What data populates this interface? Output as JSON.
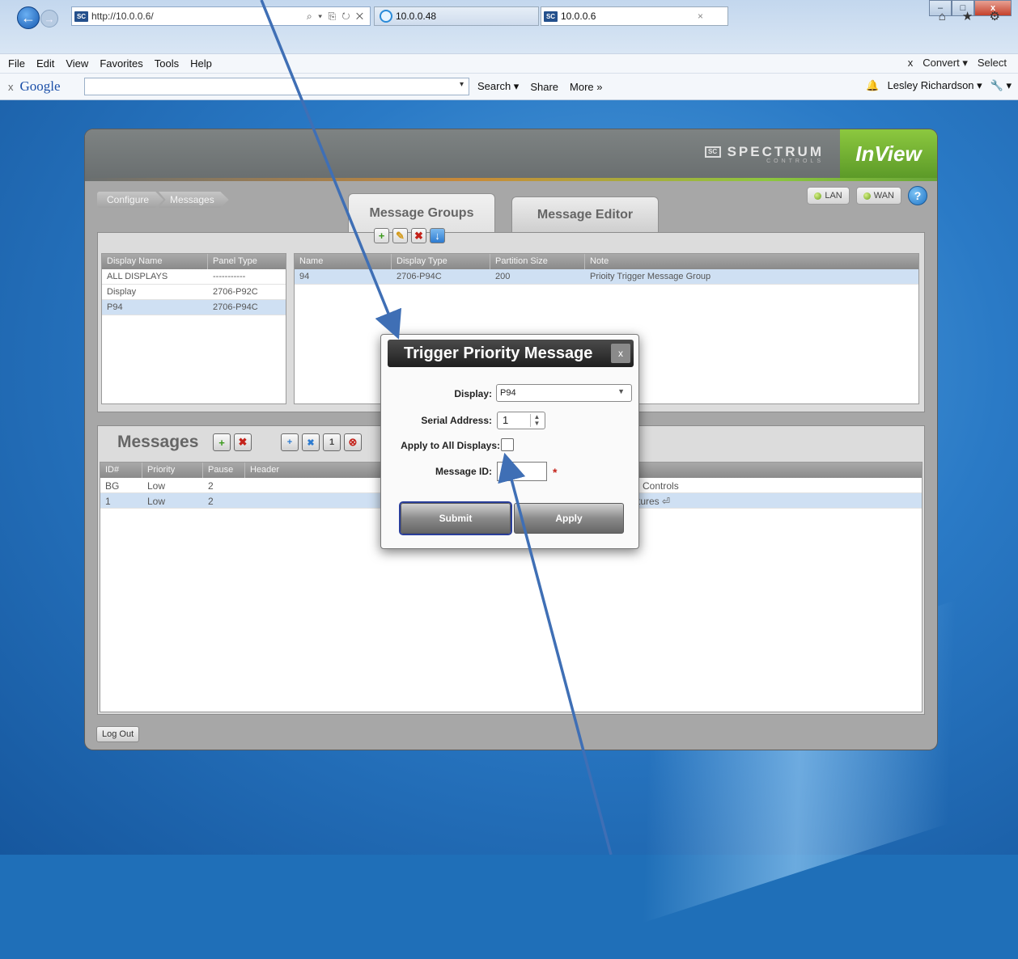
{
  "browser": {
    "address": "http://10.0.0.6/",
    "tabs": [
      {
        "label": "10.0.0.48"
      },
      {
        "label": "10.0.0.6",
        "close": "×"
      }
    ],
    "window_buttons": {
      "minimize": "–",
      "maximize": "□",
      "close": "x"
    },
    "right_icons": "⌂ ★ ⚙",
    "menu": [
      "File",
      "Edit",
      "View",
      "Favorites",
      "Tools",
      "Help"
    ],
    "menu_right": {
      "x": "x",
      "convert": "Convert ▾",
      "select": "Select"
    },
    "google": {
      "x": "x",
      "logo": "Google",
      "dropdown": "▾",
      "search": "Search ▾",
      "share": "Share",
      "more": "More »",
      "user": "Lesley Richardson ▾",
      "wrench": "🔧 ▾"
    }
  },
  "app": {
    "brand": "SPECTRUM",
    "brand_sub": "CONTROLS",
    "product": "InView",
    "breadcrumb": [
      "Configure",
      "Messages"
    ],
    "status": {
      "lan": "LAN",
      "wan": "WAN",
      "help": "?"
    },
    "tabs": {
      "groups": "Message Groups",
      "editor": "Message Editor"
    },
    "displays_table": {
      "columns": [
        "Display Name",
        "Panel Type"
      ],
      "rows": [
        [
          "ALL DISPLAYS",
          "-----------"
        ],
        [
          "Display",
          "2706-P92C"
        ],
        [
          "P94",
          "2706-P94C"
        ]
      ]
    },
    "groups_table": {
      "columns": [
        "Name",
        "Display Type",
        "Partition Size",
        "Note"
      ],
      "rows": [
        [
          "94",
          "2706-P94C",
          "200",
          "Prioity Trigger Message Group"
        ]
      ]
    },
    "messages": {
      "title": "Messages",
      "columns": [
        "ID#",
        "Priority",
        "Pause",
        "Header"
      ],
      "rows": [
        {
          "id": "BG",
          "priority": "Low",
          "pause": "2",
          "text": "n Controls"
        },
        {
          "id": "1",
          "priority": "Low",
          "pause": "2",
          "text": "rtures ⏎"
        }
      ],
      "tool_icons": {
        "add": "+",
        "delete": "✖",
        "t1": "+",
        "t2": "✖",
        "t3": "1",
        "t4": "⊗"
      }
    },
    "logout": "Log Out"
  },
  "modal": {
    "title": "Trigger Priority Message",
    "close": "x",
    "display_label": "Display:",
    "display_value": "P94",
    "serial_label": "Serial Address:",
    "serial_value": "1",
    "apply_all_label": "Apply to All Displays:",
    "message_id_label": "Message ID:",
    "required": "*",
    "submit": "Submit",
    "apply": "Apply"
  },
  "colors": {
    "arrow": "#3f6fb5",
    "inview_green": "#7ab836",
    "header_gray": "#747979",
    "selected_row": "#cfe0f3"
  }
}
